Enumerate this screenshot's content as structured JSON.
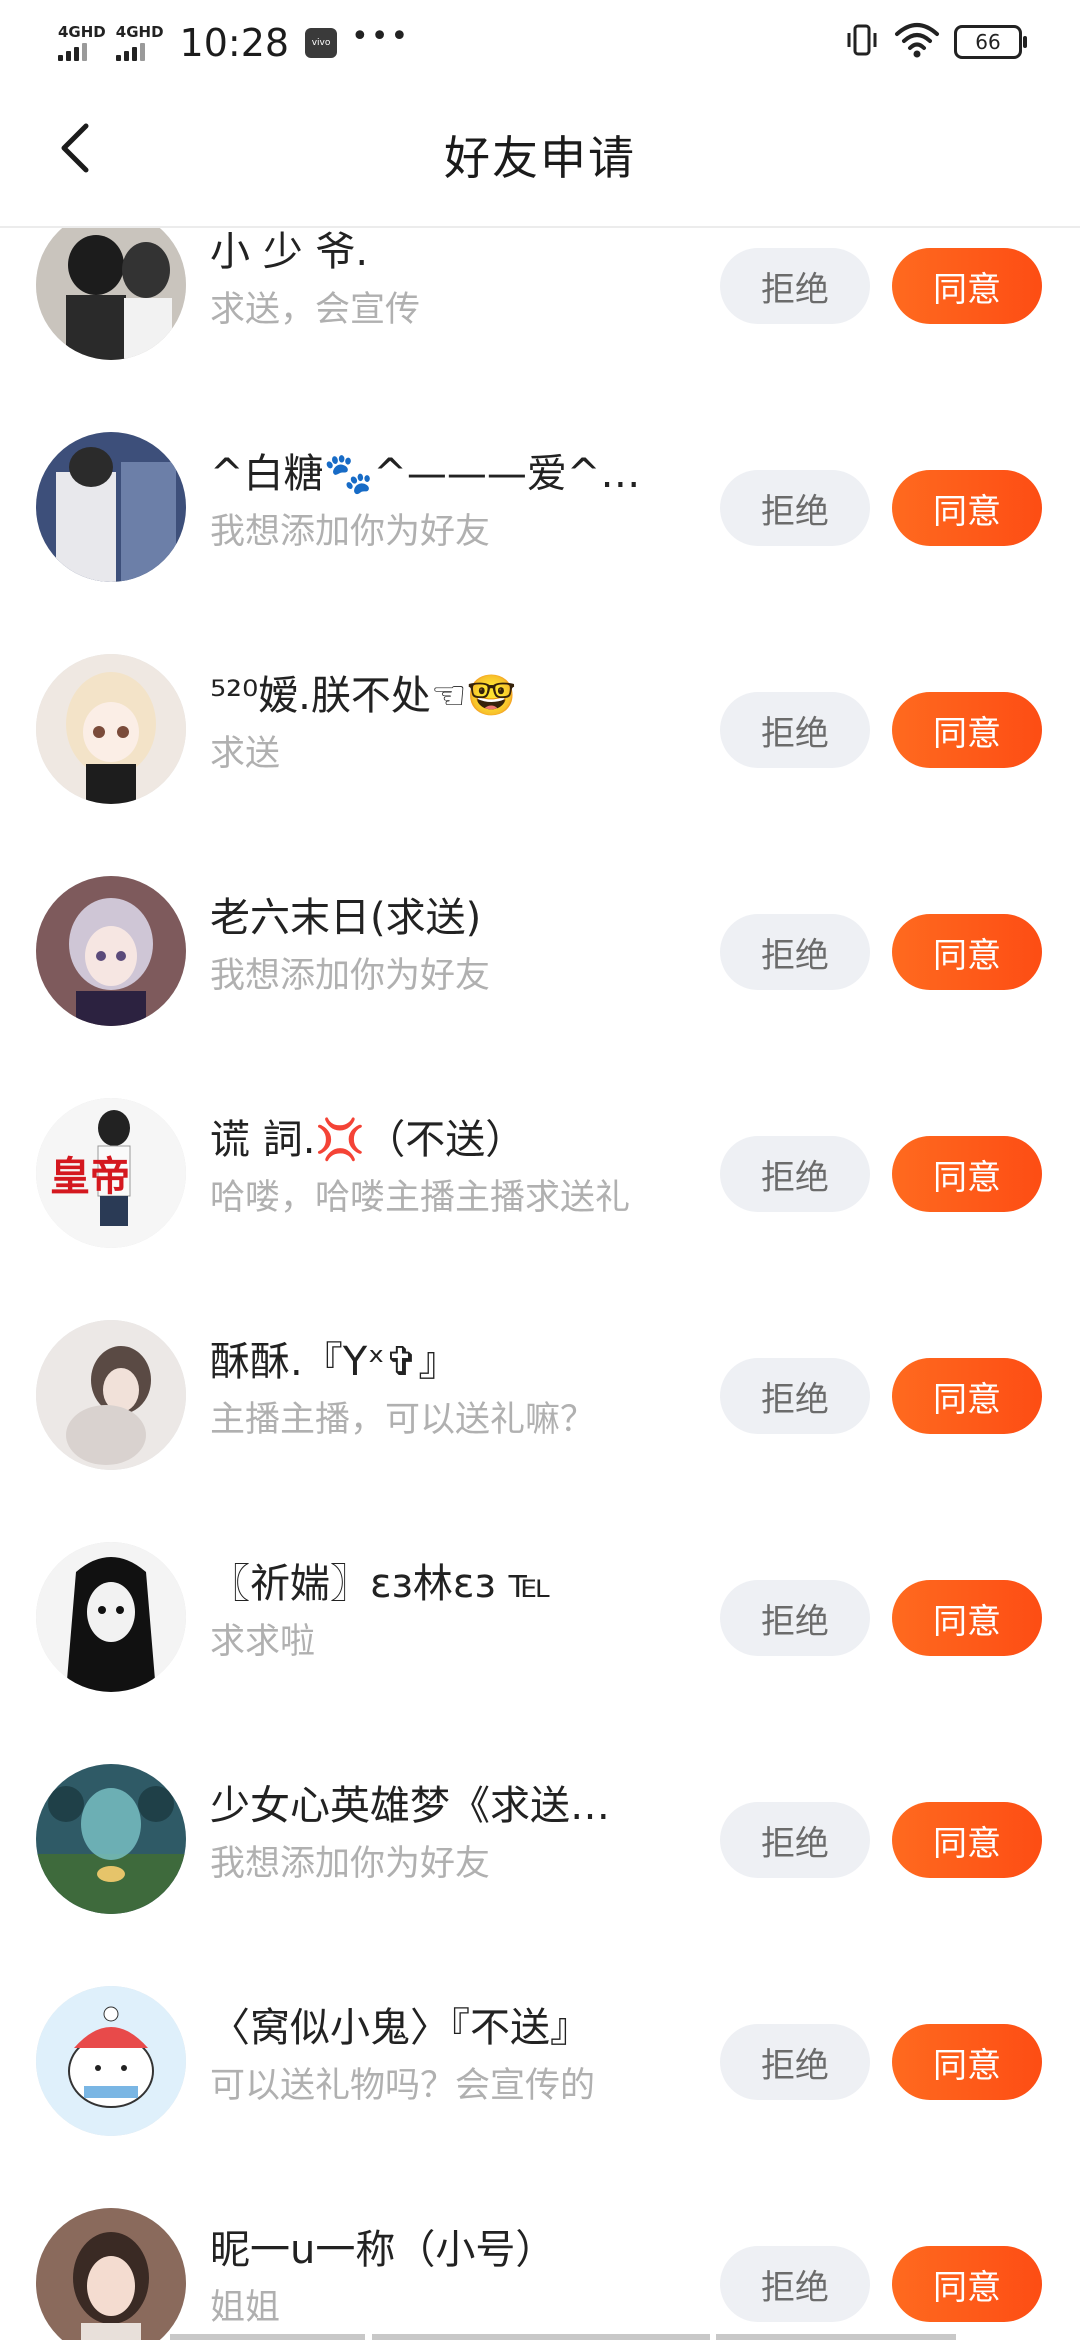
{
  "status_bar": {
    "signal1_label": "4GHD",
    "signal2_label": "4GHD",
    "time": "10:28",
    "app_badge": "vivo",
    "more": "•••",
    "battery": "66"
  },
  "header": {
    "title": "好友申请",
    "back_icon": "chevron-left-icon"
  },
  "buttons": {
    "reject_label": "拒绝",
    "agree_label": "同意"
  },
  "requests": [
    {
      "name": "小 少 爷.",
      "message": "求送，会宣传"
    },
    {
      "name": "^白糖🐾^———爱^冰…",
      "message": "我想添加你为好友"
    },
    {
      "name": "⁵²⁰嫒.朕不处☜🤓",
      "message": "求送"
    },
    {
      "name": "老六末日(求送)",
      "message": "我想添加你为好友"
    },
    {
      "name": "谎  詞.💢（不送）",
      "message": "哈喽，哈喽主播主播求送礼"
    },
    {
      "name": "酥酥.『Yˣ✞』",
      "message": "主播主播，可以送礼嘛？"
    },
    {
      "name": "〖祈媏〗εз林εз ℡",
      "message": "求求啦"
    },
    {
      "name": "少女心英雄梦《求送…",
      "message": "我想添加你为好友"
    },
    {
      "name": "〈窝似小鬼〉『不送』",
      "message": "可以送礼物吗？会宣传的"
    },
    {
      "name": "昵一u一称（小号）",
      "message": "姐姐"
    }
  ],
  "colors": {
    "agree_button": "#ff5a1a",
    "reject_button_bg": "#eef0f4",
    "message_text": "#b0b0b0"
  }
}
